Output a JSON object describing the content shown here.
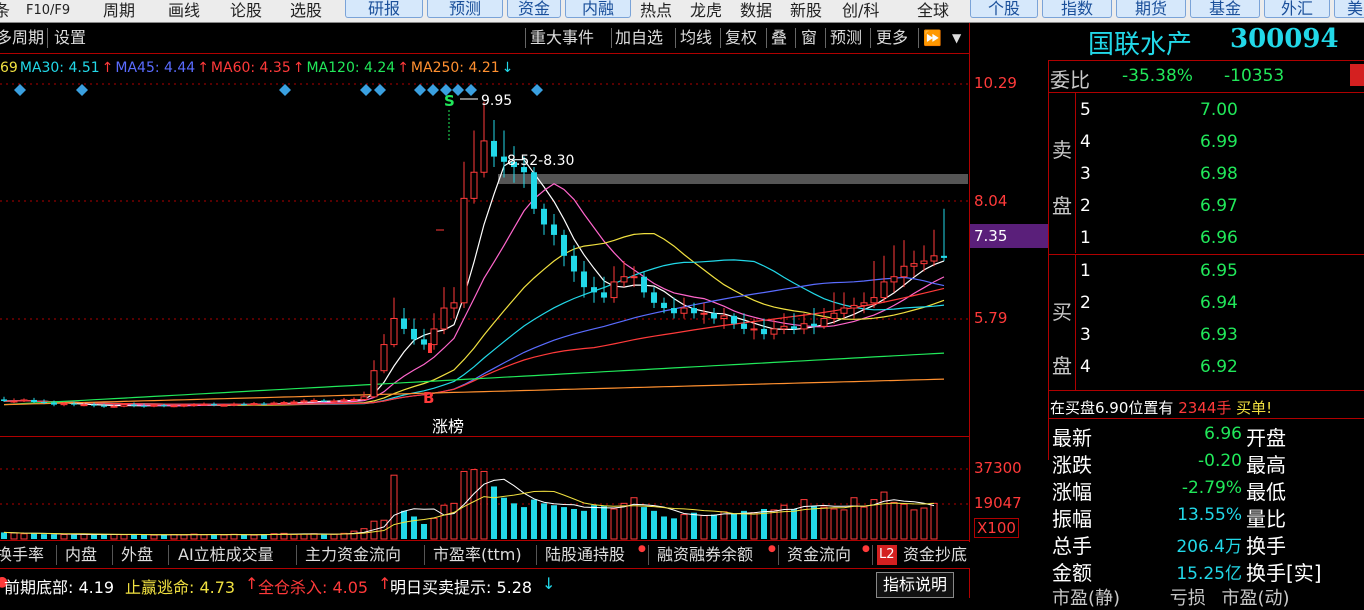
{
  "top_menu": {
    "items": [
      "F10/F9",
      "周期",
      "画线",
      "论股",
      "选股",
      "研报",
      "预测",
      "资金",
      "内融",
      "热点",
      "龙虎",
      "数据",
      "新股",
      "创/科",
      "全球",
      "个股",
      "指数",
      "期货",
      "基金",
      "外汇"
    ],
    "edge_left": "条",
    "edge_right": "美"
  },
  "toolbar": {
    "left_items": [
      "多周期",
      "设置"
    ],
    "right_items": [
      "重大事件",
      "加自选",
      "均线",
      "复权",
      "叠",
      "窗",
      "预测",
      "更多"
    ]
  },
  "ma_legend": [
    {
      "text": "69",
      "color": "#f0e040"
    },
    {
      "text": "MA30: 4.51",
      "color": "#22d8e8",
      "arrow": "↑"
    },
    {
      "text": "MA45: 4.44",
      "color": "#5a6cff",
      "arrow": "↑"
    },
    {
      "text": "MA60: 4.35",
      "color": "#ff3a3a",
      "arrow": "↑"
    },
    {
      "text": "MA120: 4.24",
      "color": "#21e85a",
      "arrow": "↑"
    },
    {
      "text": "MA250: 4.21",
      "color": "#ff9030",
      "arrow": "↓"
    }
  ],
  "price_axis": {
    "p1": "10.29",
    "p2": "8.04",
    "p3": "5.79",
    "current": "7.35"
  },
  "volume_axis": {
    "v1": "37300",
    "v2": "19047",
    "unit": "X100"
  },
  "annotations": {
    "high": "9.95",
    "resistance": "8.52-8.30",
    "s_mark": "S",
    "b_mark": "B",
    "zhangbang": "涨榜"
  },
  "chart_data": {
    "type": "candlestick",
    "ylim": [
      4.0,
      10.6
    ],
    "x": [
      0,
      1,
      2,
      3,
      4,
      5,
      6,
      7,
      8,
      9,
      10,
      11,
      12,
      13,
      14,
      15,
      16,
      17,
      18,
      19,
      20,
      21,
      22,
      23,
      24,
      25,
      26,
      27,
      28,
      29,
      30,
      31,
      32,
      33,
      34,
      35,
      36,
      37,
      38,
      39,
      40,
      41,
      42,
      43,
      44,
      45,
      46,
      47,
      48,
      49,
      50,
      51,
      52,
      53,
      54,
      55,
      56,
      57,
      58,
      59,
      60,
      61,
      62,
      63,
      64,
      65,
      66,
      67,
      68,
      69,
      70,
      71,
      72,
      73,
      74,
      75,
      76,
      77,
      78,
      79,
      80,
      81,
      82,
      83,
      84,
      85,
      86,
      87,
      88,
      89,
      90,
      91,
      92,
      93,
      94
    ],
    "open": [
      4.25,
      4.22,
      4.22,
      4.24,
      4.2,
      4.19,
      4.15,
      4.17,
      4.15,
      4.15,
      4.13,
      4.12,
      4.12,
      4.15,
      4.13,
      4.12,
      4.14,
      4.13,
      4.13,
      4.14,
      4.15,
      4.16,
      4.14,
      4.14,
      4.16,
      4.15,
      4.17,
      4.16,
      4.18,
      4.19,
      4.2,
      4.22,
      4.23,
      4.22,
      4.22,
      4.24,
      4.25,
      4.3,
      4.8,
      5.3,
      5.8,
      5.6,
      5.4,
      5.3,
      5.6,
      6.0,
      6.1,
      8.1,
      8.6,
      9.2,
      8.9,
      8.8,
      8.7,
      8.6,
      7.9,
      7.6,
      7.4,
      7.0,
      6.7,
      6.4,
      6.3,
      6.2,
      6.5,
      6.6,
      6.6,
      6.3,
      6.1,
      6.0,
      5.9,
      6.0,
      5.9,
      5.9,
      5.8,
      5.85,
      5.7,
      5.6,
      5.6,
      5.5,
      5.6,
      5.65,
      5.6,
      5.7,
      5.65,
      5.8,
      5.9,
      6.0,
      6.05,
      6.1,
      6.2,
      6.5,
      6.6,
      6.8,
      6.85,
      6.9,
      7.0
    ],
    "close": [
      4.22,
      4.22,
      4.24,
      4.2,
      4.19,
      4.15,
      4.17,
      4.15,
      4.15,
      4.13,
      4.12,
      4.12,
      4.15,
      4.13,
      4.12,
      4.14,
      4.13,
      4.13,
      4.14,
      4.15,
      4.16,
      4.14,
      4.14,
      4.16,
      4.15,
      4.17,
      4.16,
      4.18,
      4.19,
      4.2,
      4.22,
      4.23,
      4.22,
      4.22,
      4.24,
      4.25,
      4.3,
      4.8,
      5.3,
      5.8,
      5.6,
      5.4,
      5.3,
      5.6,
      6.0,
      6.1,
      8.1,
      8.6,
      9.2,
      8.9,
      8.8,
      8.7,
      8.6,
      7.9,
      7.6,
      7.4,
      7.0,
      6.7,
      6.4,
      6.3,
      6.2,
      6.5,
      6.6,
      6.6,
      6.3,
      6.1,
      6.0,
      5.9,
      6.0,
      5.9,
      5.9,
      5.8,
      5.85,
      5.7,
      5.6,
      5.6,
      5.5,
      5.6,
      5.65,
      5.6,
      5.7,
      5.65,
      5.8,
      5.9,
      6.0,
      6.05,
      6.1,
      6.2,
      6.5,
      6.6,
      6.8,
      6.85,
      6.9,
      7.0,
      6.96
    ],
    "high": [
      4.3,
      4.27,
      4.27,
      4.28,
      4.25,
      4.23,
      4.2,
      4.21,
      4.19,
      4.19,
      4.17,
      4.16,
      4.18,
      4.19,
      4.17,
      4.17,
      4.17,
      4.16,
      4.17,
      4.18,
      4.19,
      4.19,
      4.17,
      4.19,
      4.19,
      4.2,
      4.2,
      4.21,
      4.22,
      4.24,
      4.26,
      4.27,
      4.26,
      4.26,
      4.28,
      4.29,
      4.4,
      5.0,
      5.5,
      6.2,
      6.0,
      5.8,
      5.6,
      5.9,
      6.4,
      6.4,
      8.8,
      9.4,
      9.95,
      9.6,
      9.4,
      9.1,
      8.9,
      8.7,
      8.0,
      7.8,
      7.5,
      7.2,
      6.9,
      6.6,
      6.6,
      6.8,
      6.9,
      6.8,
      6.7,
      6.4,
      6.2,
      6.2,
      6.2,
      6.1,
      6.1,
      6.0,
      6.0,
      5.9,
      5.9,
      5.8,
      5.8,
      5.8,
      5.9,
      5.9,
      5.9,
      6.0,
      6.0,
      6.3,
      6.3,
      6.2,
      6.3,
      6.9,
      7.0,
      7.2,
      7.3,
      7.1,
      7.2,
      7.5,
      7.9
    ],
    "low": [
      4.2,
      4.18,
      4.2,
      4.18,
      4.16,
      4.12,
      4.12,
      4.12,
      4.12,
      4.1,
      4.09,
      4.09,
      4.1,
      4.1,
      4.09,
      4.1,
      4.1,
      4.1,
      4.1,
      4.11,
      4.13,
      4.12,
      4.12,
      4.12,
      4.13,
      4.13,
      4.14,
      4.14,
      4.16,
      4.17,
      4.18,
      4.2,
      4.2,
      4.2,
      4.2,
      4.22,
      4.25,
      4.28,
      4.75,
      5.25,
      5.5,
      5.3,
      5.2,
      5.2,
      5.5,
      5.8,
      6.0,
      8.0,
      8.5,
      8.7,
      8.5,
      8.4,
      8.3,
      7.8,
      7.4,
      7.2,
      6.8,
      6.5,
      6.2,
      6.1,
      6.1,
      6.1,
      6.4,
      6.4,
      6.2,
      6.0,
      5.9,
      5.8,
      5.8,
      5.8,
      5.7,
      5.7,
      5.6,
      5.6,
      5.5,
      5.4,
      5.4,
      5.4,
      5.5,
      5.5,
      5.5,
      5.5,
      5.6,
      5.7,
      5.8,
      5.8,
      5.9,
      6.0,
      6.1,
      6.3,
      6.4,
      6.6,
      6.7,
      6.8,
      6.9
    ],
    "volume": [
      3500,
      3200,
      2800,
      2900,
      2600,
      2500,
      2400,
      2300,
      2500,
      2200,
      2600,
      2400,
      2300,
      2500,
      2200,
      2100,
      2300,
      2400,
      2200,
      2600,
      2300,
      2400,
      2200,
      2500,
      2300,
      2100,
      2600,
      2800,
      3000,
      2500,
      2600,
      2800,
      2400,
      2600,
      3000,
      4200,
      5500,
      9500,
      10000,
      34000,
      15000,
      12000,
      8000,
      11000,
      18000,
      19000,
      36000,
      37000,
      36000,
      28000,
      22000,
      19000,
      17000,
      21000,
      19000,
      18000,
      17000,
      16000,
      15000,
      18000,
      17500,
      16000,
      19000,
      22000,
      17000,
      15000,
      12000,
      11000,
      13000,
      14000,
      12500,
      13000,
      14500,
      13500,
      15000,
      14000,
      16000,
      15500,
      18000,
      16000,
      21000,
      17500,
      17000,
      16000,
      15500,
      22000,
      17000,
      21000,
      25000,
      19500,
      18500,
      15500,
      16500,
      19000
    ],
    "ma5_approx_label": "MA5",
    "ma_lines": [
      "MA5",
      "MA10",
      "MA20",
      "MA30",
      "MA45",
      "MA60",
      "MA120",
      "MA250"
    ]
  },
  "bottom_tabs": [
    "换手率",
    "内盘",
    "外盘",
    "AI立桩成交量",
    "主力资金流向",
    "市盈率(ttm)",
    "陆股通持股",
    "融资融券余额",
    "资金流向",
    "L2",
    "资金抄底"
  ],
  "status_line": {
    "prefix": "前期底部: 4.19",
    "stop": "止赢逃命: 4.73",
    "stop_arrow": "↑",
    "buy": "全仓杀入: 4.05",
    "buy_arrow": "↑",
    "hint": "明日买卖提示: 5.28",
    "hint_arrow": "↓",
    "explain": "指标说明"
  },
  "right_panel": {
    "name": "国联水产",
    "code": "300094",
    "weibi_label": "委比",
    "weibi_pct": "-35.38%",
    "weibi_val": "-10353",
    "sell_label": [
      "卖",
      "盘"
    ],
    "sell": [
      {
        "n": "5",
        "price": "7.00"
      },
      {
        "n": "4",
        "price": "6.99"
      },
      {
        "n": "3",
        "price": "6.98"
      },
      {
        "n": "2",
        "price": "6.97"
      },
      {
        "n": "1",
        "price": "6.96"
      }
    ],
    "buy_label": [
      "买",
      "盘"
    ],
    "buy": [
      {
        "n": "1",
        "price": "6.95"
      },
      {
        "n": "2",
        "price": "6.94"
      },
      {
        "n": "3",
        "price": "6.93"
      },
      {
        "n": "4",
        "price": "6.92"
      }
    ],
    "notice": {
      "a": "在买盘6.90位置有",
      "b": "2344手",
      "c": "买单!"
    },
    "stats": [
      {
        "label": "最新",
        "value": "6.96",
        "label2": "开盘"
      },
      {
        "label": "涨跌",
        "value": "-0.20",
        "label2": "最高"
      },
      {
        "label": "涨幅",
        "value": "-2.79%",
        "label2": "最低"
      },
      {
        "label": "振幅",
        "value": "13.55%",
        "label2": "量比"
      },
      {
        "label": "总手",
        "value": "206.4万",
        "label2": "换手"
      },
      {
        "label": "金额",
        "value": "15.25亿",
        "label2": "换手[实]"
      }
    ],
    "stats_tail": {
      "a": "市盈(静)",
      "b": "亏损",
      "c": "市盈(动)"
    }
  },
  "colors": {
    "up": "#ff3a3a",
    "down": "#22d8e8",
    "bg": "#000000",
    "grid": "#b00000"
  }
}
